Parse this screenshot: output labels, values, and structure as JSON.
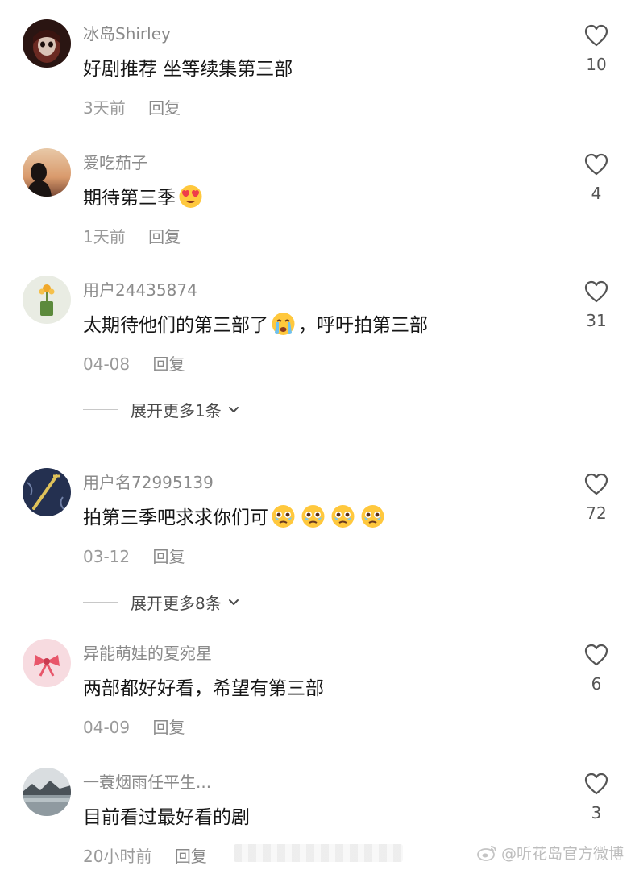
{
  "comments": [
    {
      "username": "冰岛Shirley",
      "text": "好剧推荐 坐等续集第三部",
      "time": "3天前",
      "reply": "回复",
      "likes": "10",
      "avatar": "dark-doll-avatar"
    },
    {
      "username": "爱吃茄子",
      "text": "期待第三季",
      "emoji": "heart-eyes-emoji",
      "time": "1天前",
      "reply": "回复",
      "likes": "4",
      "avatar": "sunset-silhouette-avatar"
    },
    {
      "username": "用户24435874",
      "text_before": "太期待他们的第三部了",
      "emoji": "crying-emoji",
      "text_after": "，呼吁拍第三部",
      "time": "04-08",
      "reply": "回复",
      "likes": "31",
      "avatar": "flower-pot-avatar",
      "expand": "展开更多1条"
    },
    {
      "username": "用户名72995139",
      "text": "拍第三季吧求求你们可",
      "emoji_count": 4,
      "emoji": "pleading-tears-emoji",
      "time": "03-12",
      "reply": "回复",
      "likes": "72",
      "avatar": "dark-blue-sword-avatar",
      "expand": "展开更多8条"
    },
    {
      "username": "异能萌娃的夏宛星",
      "text": "两部都好好看，希望有第三部",
      "time": "04-09",
      "reply": "回复",
      "likes": "6",
      "avatar": "pink-bow-avatar"
    },
    {
      "username": "一蓑烟雨任平生...",
      "text": "目前看过最好看的剧",
      "time": "20小时前",
      "reply": "回复",
      "likes": "3",
      "avatar": "lake-landscape-avatar"
    }
  ],
  "watermark": "@听花岛官方微博",
  "colors": {
    "username": "#8a8a8a",
    "text": "#161616",
    "meta": "#9a9a9a",
    "like_icon": "#555555",
    "watermark": "#bdbdbd"
  }
}
